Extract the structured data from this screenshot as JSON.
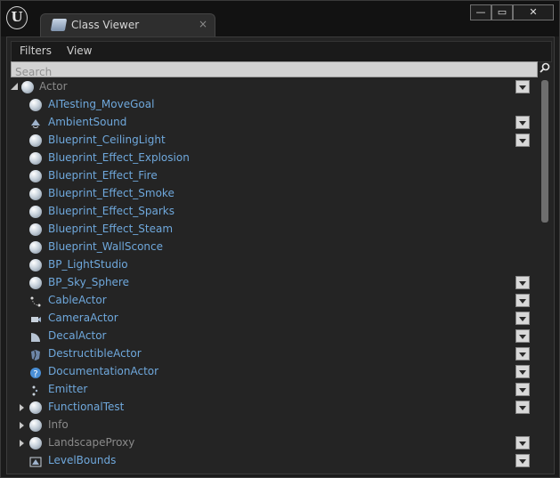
{
  "window": {
    "tab_title": "Class Viewer",
    "tab_close": "×",
    "controls": {
      "minimize": "—",
      "maximize": "▭",
      "close": "✕"
    }
  },
  "menu": {
    "filters": "Filters",
    "view": "View"
  },
  "search": {
    "placeholder": "Search"
  },
  "tree": [
    {
      "label": "Actor",
      "style": "grey",
      "expander": "expanded",
      "icon": "sphere-icon",
      "dropdown": true,
      "indent": 0
    },
    {
      "label": "AITesting_MoveGoal",
      "style": "blue",
      "expander": "none",
      "icon": "sphere-icon",
      "dropdown": false,
      "indent": 1
    },
    {
      "label": "AmbientSound",
      "style": "blue",
      "expander": "none",
      "icon": "sound-icon",
      "dropdown": true,
      "indent": 1
    },
    {
      "label": "Blueprint_CeilingLight",
      "style": "blue",
      "expander": "none",
      "icon": "sphere-icon",
      "dropdown": true,
      "indent": 1
    },
    {
      "label": "Blueprint_Effect_Explosion",
      "style": "blue",
      "expander": "none",
      "icon": "sphere-icon",
      "dropdown": false,
      "indent": 1
    },
    {
      "label": "Blueprint_Effect_Fire",
      "style": "blue",
      "expander": "none",
      "icon": "sphere-icon",
      "dropdown": false,
      "indent": 1
    },
    {
      "label": "Blueprint_Effect_Smoke",
      "style": "blue",
      "expander": "none",
      "icon": "sphere-icon",
      "dropdown": false,
      "indent": 1
    },
    {
      "label": "Blueprint_Effect_Sparks",
      "style": "blue",
      "expander": "none",
      "icon": "sphere-icon",
      "dropdown": false,
      "indent": 1
    },
    {
      "label": "Blueprint_Effect_Steam",
      "style": "blue",
      "expander": "none",
      "icon": "sphere-icon",
      "dropdown": false,
      "indent": 1
    },
    {
      "label": "Blueprint_WallSconce",
      "style": "blue",
      "expander": "none",
      "icon": "sphere-icon",
      "dropdown": false,
      "indent": 1
    },
    {
      "label": "BP_LightStudio",
      "style": "blue",
      "expander": "none",
      "icon": "sphere-icon",
      "dropdown": false,
      "indent": 1
    },
    {
      "label": "BP_Sky_Sphere",
      "style": "blue",
      "expander": "none",
      "icon": "sphere-icon",
      "dropdown": true,
      "indent": 1
    },
    {
      "label": "CableActor",
      "style": "blue",
      "expander": "none",
      "icon": "cable-icon",
      "dropdown": true,
      "indent": 1
    },
    {
      "label": "CameraActor",
      "style": "blue",
      "expander": "none",
      "icon": "camera-icon",
      "dropdown": true,
      "indent": 1
    },
    {
      "label": "DecalActor",
      "style": "blue",
      "expander": "none",
      "icon": "decal-icon",
      "dropdown": true,
      "indent": 1
    },
    {
      "label": "DestructibleActor",
      "style": "blue",
      "expander": "none",
      "icon": "destructible-icon",
      "dropdown": true,
      "indent": 1
    },
    {
      "label": "DocumentationActor",
      "style": "blue",
      "expander": "none",
      "icon": "help-icon",
      "dropdown": true,
      "indent": 1
    },
    {
      "label": "Emitter",
      "style": "blue",
      "expander": "none",
      "icon": "emitter-icon",
      "dropdown": true,
      "indent": 1
    },
    {
      "label": "FunctionalTest",
      "style": "blue",
      "expander": "collapsed",
      "icon": "sphere-icon",
      "dropdown": true,
      "indent": 1
    },
    {
      "label": "Info",
      "style": "grey",
      "expander": "collapsed",
      "icon": "sphere-icon",
      "dropdown": false,
      "indent": 1
    },
    {
      "label": "LandscapeProxy",
      "style": "grey",
      "expander": "collapsed",
      "icon": "sphere-icon",
      "dropdown": true,
      "indent": 1
    },
    {
      "label": "LevelBounds",
      "style": "blue",
      "expander": "none",
      "icon": "level-bounds-icon",
      "dropdown": true,
      "indent": 1
    }
  ]
}
